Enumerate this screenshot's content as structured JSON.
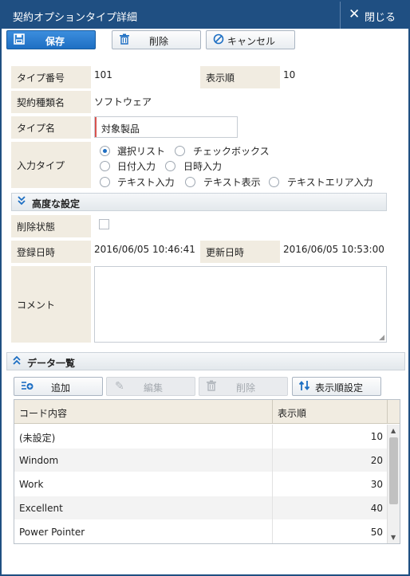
{
  "window": {
    "title": "契約オプションタイプ詳細",
    "close_label": "閉じる"
  },
  "toolbar": {
    "save_label": "保存",
    "delete_label": "削除",
    "cancel_label": "キャンセル"
  },
  "form": {
    "type_no_label": "タイプ番号",
    "type_no_value": "101",
    "display_order_label": "表示順",
    "display_order_value": "10",
    "contract_kind_label": "契約種類名",
    "contract_kind_value": "ソフトウェア",
    "type_name_label": "タイプ名",
    "type_name_value": "対象製品",
    "input_type_label": "入力タイプ",
    "input_type_options": [
      "選択リスト",
      "チェックボックス",
      "日付入力",
      "日時入力",
      "テキスト入力",
      "テキスト表示",
      "テキストエリア入力"
    ],
    "input_type_selected": "選択リスト"
  },
  "advanced": {
    "section_title": "高度な設定",
    "deleted_label": "削除状態",
    "deleted_checked": false,
    "registered_label": "登録日時",
    "registered_value": "2016/06/05 10:46:41",
    "updated_label": "更新日時",
    "updated_value": "2016/06/05 10:53:00",
    "comment_label": "コメント",
    "comment_value": ""
  },
  "data_list": {
    "section_title": "データ一覧",
    "add_label": "追加",
    "edit_label": "編集",
    "delete_label": "削除",
    "order_label": "表示順設定",
    "columns": [
      "コード内容",
      "表示順"
    ],
    "rows": [
      {
        "name": "(未設定)",
        "order": "10"
      },
      {
        "name": "Windom",
        "order": "20"
      },
      {
        "name": "Work",
        "order": "30"
      },
      {
        "name": "Excellent",
        "order": "40"
      },
      {
        "name": "Power Pointer",
        "order": "50"
      }
    ]
  },
  "colors": {
    "titlebar": "#1f4f82",
    "primary": "#1e6fc3",
    "label_bg": "#f1ece1",
    "required_marker": "#d9534f"
  }
}
